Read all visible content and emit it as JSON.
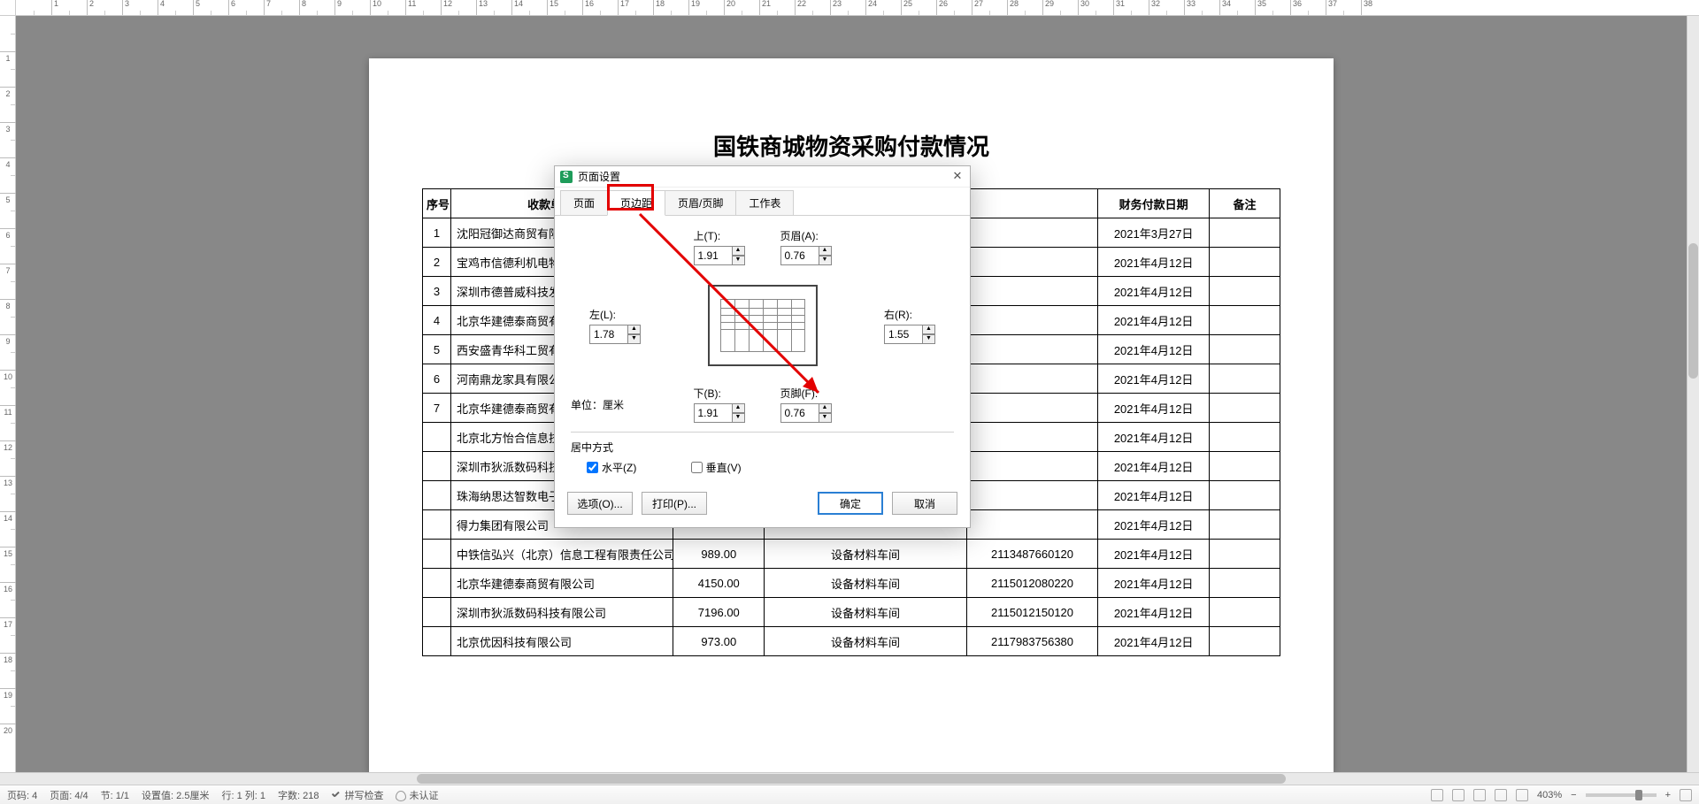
{
  "doc": {
    "title": "国铁商城物资采购付款情况",
    "headers": {
      "idx": "序号",
      "name": "收款单位名称",
      "amt": "",
      "dept": "",
      "acct": "",
      "date": "财务付款日期",
      "note": "备注"
    },
    "rows": [
      {
        "idx": "1",
        "name": "沈阳冠御达商贸有限公司",
        "amt": "",
        "dept": "",
        "acct": "",
        "date": "2021年3月27日",
        "note": ""
      },
      {
        "idx": "2",
        "name": "宝鸡市信德利机电物资有限公司",
        "amt": "",
        "dept": "",
        "acct": "",
        "date": "2021年4月12日",
        "note": ""
      },
      {
        "idx": "3",
        "name": "深圳市德普威科技发展有限公司",
        "amt": "",
        "dept": "",
        "acct": "",
        "date": "2021年4月12日",
        "note": ""
      },
      {
        "idx": "4",
        "name": "北京华建德泰商贸有限公司",
        "amt": "",
        "dept": "",
        "acct": "",
        "date": "2021年4月12日",
        "note": ""
      },
      {
        "idx": "5",
        "name": "西安盛青华科工贸有限公司",
        "amt": "",
        "dept": "",
        "acct": "",
        "date": "2021年4月12日",
        "note": ""
      },
      {
        "idx": "6",
        "name": "河南鼎龙家具有限公司",
        "amt": "",
        "dept": "",
        "acct": "",
        "date": "2021年4月12日",
        "note": ""
      },
      {
        "idx": "7",
        "name": "北京华建德泰商贸有限公司",
        "amt": "",
        "dept": "",
        "acct": "",
        "date": "2021年4月12日",
        "note": ""
      },
      {
        "idx": "",
        "name": "北京北方怡合信息技术有限公司",
        "amt": "",
        "dept": "",
        "acct": "",
        "date": "2021年4月12日",
        "note": ""
      },
      {
        "idx": "",
        "name": "深圳市狄派数码科技有限公司",
        "amt": "",
        "dept": "",
        "acct": "",
        "date": "2021年4月12日",
        "note": ""
      },
      {
        "idx": "",
        "name": "珠海纳思达智数电子商务有限公司",
        "amt": "",
        "dept": "",
        "acct": "",
        "date": "2021年4月12日",
        "note": ""
      },
      {
        "idx": "",
        "name": "得力集团有限公司",
        "amt": "",
        "dept": "",
        "acct": "",
        "date": "2021年4月12日",
        "note": ""
      },
      {
        "idx": "",
        "name": "中铁信弘兴（北京）信息工程有限责任公司",
        "amt": "989.00",
        "dept": "设备材料车间",
        "acct": "2113487660120",
        "date": "2021年4月12日",
        "note": ""
      },
      {
        "idx": "",
        "name": "北京华建德泰商贸有限公司",
        "amt": "4150.00",
        "dept": "设备材料车间",
        "acct": "2115012080220",
        "date": "2021年4月12日",
        "note": ""
      },
      {
        "idx": "",
        "name": "深圳市狄派数码科技有限公司",
        "amt": "7196.00",
        "dept": "设备材料车间",
        "acct": "2115012150120",
        "date": "2021年4月12日",
        "note": ""
      },
      {
        "idx": "",
        "name": "北京优因科技有限公司",
        "amt": "973.00",
        "dept": "设备材料车间",
        "acct": "2117983756380",
        "date": "2021年4月12日",
        "note": ""
      }
    ]
  },
  "dialog": {
    "title": "页面设置",
    "tabs": {
      "page": "页面",
      "margin": "页边距",
      "headerfooter": "页眉/页脚",
      "sheet": "工作表"
    },
    "labels": {
      "top": "上(T):",
      "bottom": "下(B):",
      "left": "左(L):",
      "right": "右(R):",
      "header": "页眉(A):",
      "footer": "页脚(F):",
      "unit": "单位：厘米",
      "center": "居中方式",
      "hcenter": "水平(Z)",
      "vcenter": "垂直(V)",
      "options": "选项(O)...",
      "print": "打印(P)...",
      "ok": "确定",
      "cancel": "取消"
    },
    "values": {
      "top": "1.91",
      "bottom": "1.91",
      "left": "1.78",
      "right": "1.55",
      "header": "0.76",
      "footer": "0.76",
      "hcenter": true,
      "vcenter": false
    },
    "active_tab": "margin"
  },
  "statusbar": {
    "page_code": "页码: 4",
    "page_of": "页面: 4/4",
    "section": "节: 1/1",
    "setting": "设置值: 2.5厘米",
    "rowcol": "行: 1  列: 1",
    "chars": "字数: 218",
    "spell": "拼写检查",
    "auth": "未认证",
    "zoom": "403%"
  }
}
